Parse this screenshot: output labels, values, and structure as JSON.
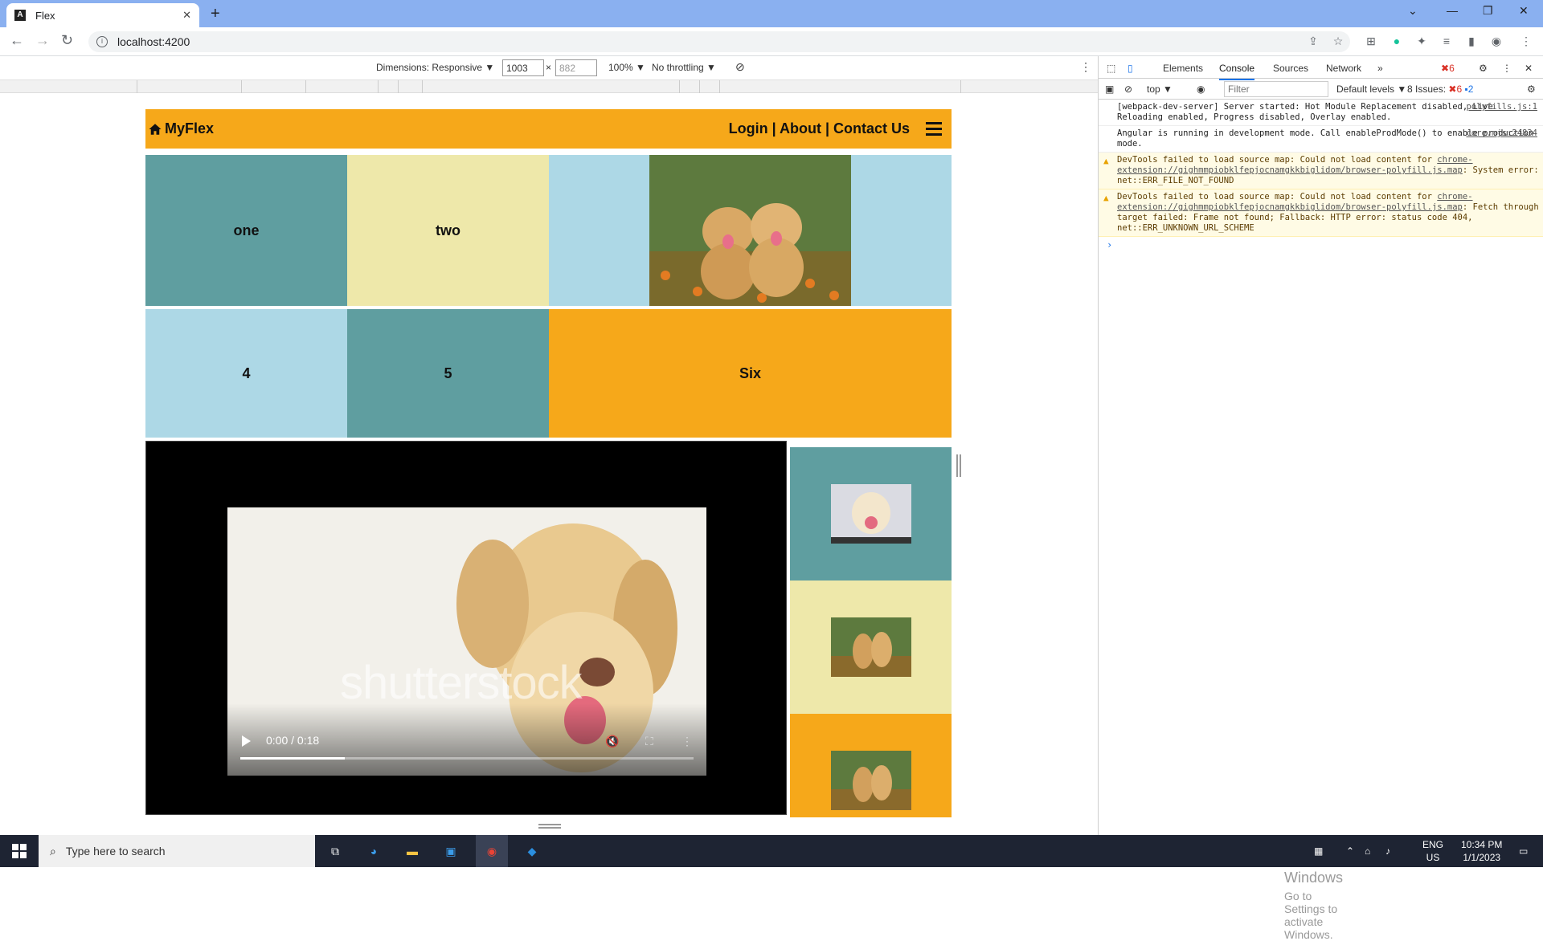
{
  "browser": {
    "tab_title": "Flex",
    "tab_icon": "A",
    "url": "localhost:4200",
    "new_tab": "+",
    "close_tab": "✕"
  },
  "device_toolbar": {
    "dimensions": "Dimensions: Responsive ▼",
    "width": "1003",
    "x": "×",
    "height": "882",
    "zoom": "100% ▼",
    "throttle": "No throttling ▼"
  },
  "app": {
    "brand": "MyFlex",
    "nav_links": "Login | About | Contact Us",
    "colors": {
      "orange": "#f6a81a",
      "teal": "#5f9ea0",
      "khaki": "#eee8aa",
      "lightblue": "#add8e6"
    },
    "cells": {
      "one": "one",
      "two": "two",
      "four": "4",
      "five": "5",
      "six": "Six"
    },
    "video": {
      "time": "0:00 / 0:18",
      "progress": 0.23,
      "watermark": "shutterstock"
    }
  },
  "devtools": {
    "tabs": [
      "Elements",
      "Console",
      "Sources",
      "Network"
    ],
    "more": "»",
    "error_count": "6",
    "context": "top ▼",
    "filter_placeholder": "Filter",
    "levels": "Default levels ▼",
    "issues": "8 Issues:",
    "issues_err": "6",
    "issues_info": "2",
    "messages": [
      {
        "text": "[webpack-dev-server] Server started: Hot Module Replacement disabled, Live Reloading enabled, Progress disabled, Overlay enabled.",
        "source": "polyfills.js:1",
        "level": "info"
      },
      {
        "text": "Angular is running in development mode. Call enableProdMode() to enable production mode.",
        "source": "core.mjs:24834",
        "level": "info"
      },
      {
        "text_pre": "DevTools failed to load source map: Could not load content for ",
        "link": "chrome-extension://gighmmpiobklfepjocnamgkkbiglidom/browser-polyfill.js.map",
        "text_post": ": System error: net::ERR_FILE_NOT_FOUND",
        "level": "warn"
      },
      {
        "text_pre": "DevTools failed to load source map: Could not load content for ",
        "link": "chrome-extension://gighmmpiobklfepjocnamgkkbiglidom/browser-polyfill.js.map",
        "text_post": ": Fetch through target failed: Frame not found; Fallback: HTTP error: status code 404, net::ERR_UNKNOWN_URL_SCHEME",
        "level": "warn"
      }
    ],
    "prompt": "›"
  },
  "watermark": {
    "line1": "Activate Windows",
    "line2": "Go to Settings to activate Windows."
  },
  "taskbar": {
    "search_placeholder": "Type here to search",
    "lang1": "ENG",
    "lang2": "US",
    "time": "10:34 PM",
    "date": "1/1/2023"
  }
}
